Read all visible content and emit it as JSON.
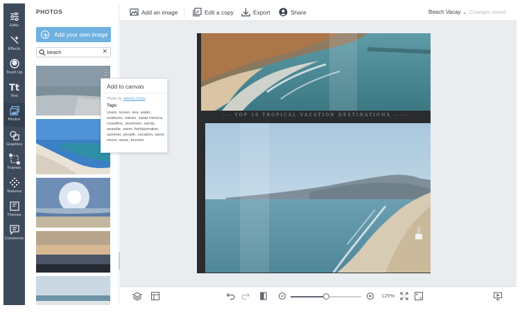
{
  "rail": {
    "items": [
      {
        "label": "Edits",
        "icon": "sliders-icon"
      },
      {
        "label": "Effects",
        "icon": "wand-icon"
      },
      {
        "label": "Touch Up",
        "icon": "face-icon"
      },
      {
        "label": "Text",
        "icon": "text-icon"
      },
      {
        "label": "Photos",
        "icon": "photos-icon",
        "active": true
      },
      {
        "label": "Graphics",
        "icon": "shapes-icon"
      },
      {
        "label": "Frames",
        "icon": "frame-icon"
      },
      {
        "label": "Textures",
        "icon": "texture-icon"
      },
      {
        "label": "Themes",
        "icon": "themes-icon"
      },
      {
        "label": "Comments",
        "icon": "comment-icon"
      }
    ]
  },
  "panel": {
    "title": "PHOTOS",
    "add_button": "Add your own image",
    "search_value": "beach"
  },
  "tooltip": {
    "title": "Add to canvas",
    "photo_by_prefix": "Photo by",
    "author": "Johnny Chau",
    "tags_label": "Tags:",
    "tags": "coast, ocean, sea, water, outdoors, nature, santa monica, coastline, seashore, sandy, seaside, swim, holidaymaker, summer, people, vacation, sand, shore, wave, tourism"
  },
  "toolbar": {
    "add_image": "Add an image",
    "edit_copy": "Edit a copy",
    "export": "Export",
    "share": "Share",
    "doc_name": "Beach Vacay",
    "status": "Changes saved"
  },
  "canvas": {
    "caption": "--- TOP 10 TROPICAL VACATION DESTINATIONS -----"
  },
  "bottombar": {
    "zoom_label": "125%",
    "zoom_fraction": 0.5
  },
  "colors": {
    "rail_bg": "#3c4a5c",
    "accent": "#6fb1e0",
    "page_bg": "#2a2b2c"
  }
}
